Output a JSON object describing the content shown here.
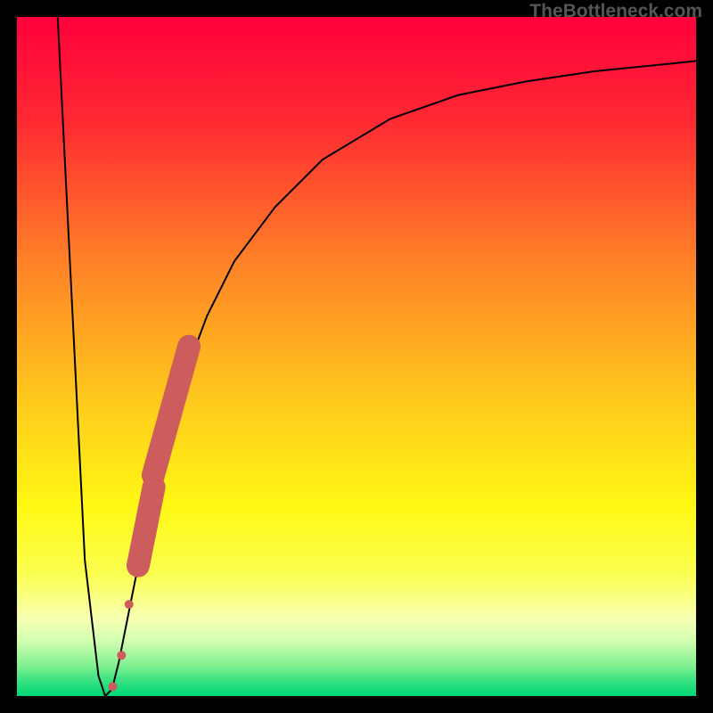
{
  "watermark": "TheBottleneck.com",
  "chart_data": {
    "type": "line",
    "title": "",
    "xlabel": "",
    "ylabel": "",
    "xlim": [
      0,
      100
    ],
    "ylim": [
      0,
      100
    ],
    "series": [
      {
        "name": "bottleneck-curve",
        "x": [
          6,
          8,
          10,
          12,
          13,
          14,
          15,
          16,
          18,
          20,
          22,
          25,
          28,
          32,
          38,
          45,
          55,
          65,
          75,
          85,
          95,
          100
        ],
        "y": [
          100,
          60,
          20,
          3,
          0,
          1,
          5,
          10,
          20,
          30,
          38,
          48,
          56,
          64,
          72,
          79,
          85,
          88.5,
          90.5,
          92,
          93,
          93.5
        ],
        "color": "#000000"
      }
    ],
    "markers": {
      "name": "highlighted-points",
      "color": "#cd5c5c",
      "points": [
        {
          "x": 14.1,
          "y": 1.4,
          "r": 5
        },
        {
          "x": 15.4,
          "y": 6.0,
          "r": 5
        },
        {
          "x": 16.5,
          "y": 13.5,
          "r": 5
        },
        {
          "x": 19.0,
          "y": 25.0,
          "r": 13,
          "elongated": true
        },
        {
          "x": 22.7,
          "y": 42.0,
          "r": 13,
          "elongated": true
        }
      ]
    },
    "background_gradient": {
      "type": "vertical",
      "stops": [
        {
          "pos": 0.0,
          "color": "#ff003c"
        },
        {
          "pos": 0.15,
          "color": "#ff2832"
        },
        {
          "pos": 0.35,
          "color": "#ff7d28"
        },
        {
          "pos": 0.55,
          "color": "#ffc51e"
        },
        {
          "pos": 0.72,
          "color": "#fff814"
        },
        {
          "pos": 0.82,
          "color": "#fbff50"
        },
        {
          "pos": 0.885,
          "color": "#f8ffb0"
        },
        {
          "pos": 0.92,
          "color": "#d0ffb0"
        },
        {
          "pos": 0.955,
          "color": "#80f090"
        },
        {
          "pos": 0.98,
          "color": "#30e080"
        },
        {
          "pos": 1.0,
          "color": "#00d878"
        }
      ]
    }
  }
}
